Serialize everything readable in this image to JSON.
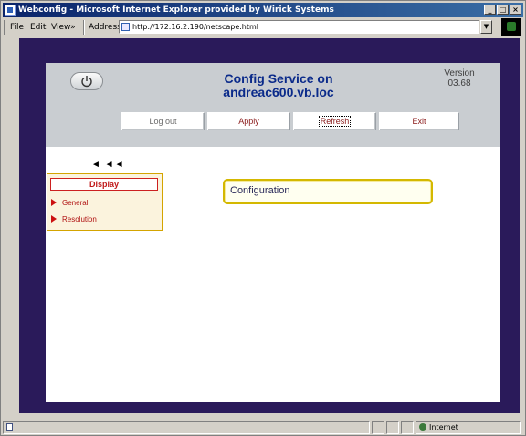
{
  "window": {
    "title": "Webconfig - Microsoft Internet Explorer provided by Wirick Systems",
    "controls": {
      "minimize": "_",
      "maximize": "□",
      "close": "×"
    }
  },
  "menubar": {
    "items": [
      "File",
      "Edit",
      "View",
      "»",
      "Address"
    ]
  },
  "address": {
    "url": "http://172.16.2.190/netscape.html"
  },
  "header": {
    "title_line1": "Config Service on",
    "title_line2": "andreac600.vb.loc",
    "version_label": "Version",
    "version_value": "03.68"
  },
  "nav_buttons": {
    "logout": "Log out",
    "apply": "Apply",
    "refresh": "Refresh",
    "exit": "Exit"
  },
  "content": {
    "back_arrows": "◄ ◄◄",
    "side_menu": {
      "header": "Display",
      "items": [
        "General",
        "Resolution"
      ]
    },
    "panel_title": "Configuration"
  },
  "statusbar": {
    "zone": "Internet"
  },
  "colors": {
    "frame": "#2a1a5a",
    "header_bg": "#c9cdd1",
    "title_text": "#0a2a8a",
    "menu_red": "#c01818",
    "menu_bg": "#fbf3dd",
    "config_border": "#d4b800"
  }
}
